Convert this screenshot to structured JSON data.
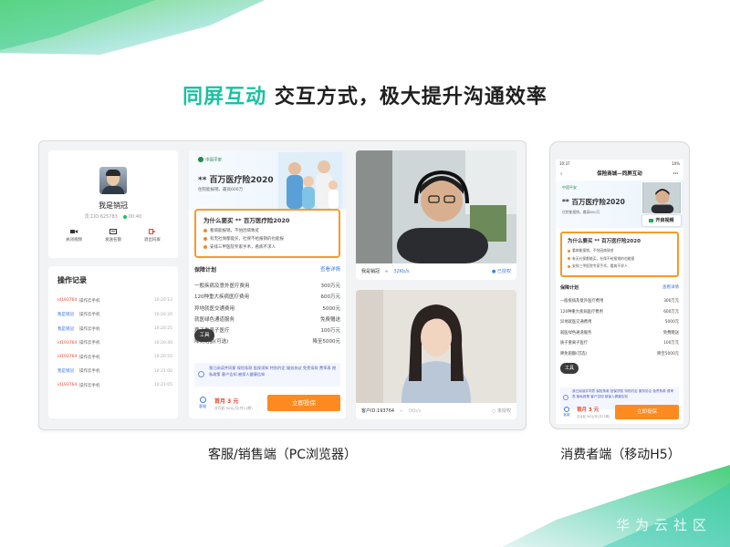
{
  "headline": {
    "highlight": "同屏互动",
    "rest": "交互方式，极大提升沟通效率"
  },
  "agent": {
    "name": "我是销冠",
    "id_label": "员工ID:625783",
    "online_time": "00:40",
    "actions": [
      "关闭视频",
      "发送名额",
      "退出同屏"
    ]
  },
  "log": {
    "title": "操作记录",
    "rows": [
      {
        "who": "id193764",
        "action": "操作云手机",
        "time": "10:20:13",
        "color": "#e8442b"
      },
      {
        "who": "我是销冠",
        "action": "操作云手机",
        "time": "10:20:20",
        "color": "#3a7be0"
      },
      {
        "who": "我是销冠",
        "action": "操作云手机",
        "time": "10:20:25",
        "color": "#3a7be0"
      },
      {
        "who": "id193764",
        "action": "操作云手机",
        "time": "10:20:40",
        "color": "#e8442b"
      },
      {
        "who": "id193764",
        "action": "操作云手机",
        "time": "10:20:55",
        "color": "#e8442b"
      },
      {
        "who": "我是销冠",
        "action": "操作云手机",
        "time": "10:21:00",
        "color": "#3a7be0"
      },
      {
        "who": "id193764",
        "action": "操作云手机",
        "time": "10:21:05",
        "color": "#e8442b"
      }
    ]
  },
  "product": {
    "brand": "中国平安",
    "title": "** 百万医疗险2020",
    "subtitle": "住院能报销，最高600万",
    "why_title": "为什么要买 ** 百万医疗险2020",
    "why_items": [
      "看病能报销，不怕因病致贫",
      "有无社保都能买，社保不给报销的也能报",
      "安排三甲医院专家手术，看病不求人"
    ],
    "plan_title": "保障计划",
    "plan_more": "查看详情",
    "plan_rows": [
      {
        "label": "一般疾病及意外医疗费用",
        "value": "300万元"
      },
      {
        "label": "120种重大疾病医疗费用",
        "value": "600万元"
      },
      {
        "label": "异地就医交通费用",
        "value": "5000元"
      },
      {
        "label": "就医绿色通道服务",
        "value": "免费赠送"
      },
      {
        "label": "质子重离子医疗",
        "value": "100万元"
      },
      {
        "label": "降免赔额(可选)",
        "value": "降至5000元"
      }
    ],
    "tool_label": "工具",
    "agree_text": "我已阅读并同意 保险条款  投保须知  特别约定  服务协议  免责条款  费率表  隐私政策  客户告知  被保人健康告知",
    "cs_label": "客服",
    "price": "首月 3 元",
    "price_sub": "次月起 90元/月(共11期)",
    "buy_label": "立即投保"
  },
  "video_agent": {
    "name": "我是销冠",
    "signal": "32Kb/s",
    "status": "已授权"
  },
  "video_customer": {
    "name": "客户ID:193764",
    "signal": "0Kb/s",
    "status": "未授权"
  },
  "phone": {
    "time": "10:37",
    "battery": "10%",
    "nav_title": "保险商城—同屏互动",
    "video_button": "开启视频"
  },
  "captions": {
    "left": "客服/销售端（PC浏览器）",
    "right": "消费者端（移动H5）"
  },
  "watermark": "华为云社区"
}
